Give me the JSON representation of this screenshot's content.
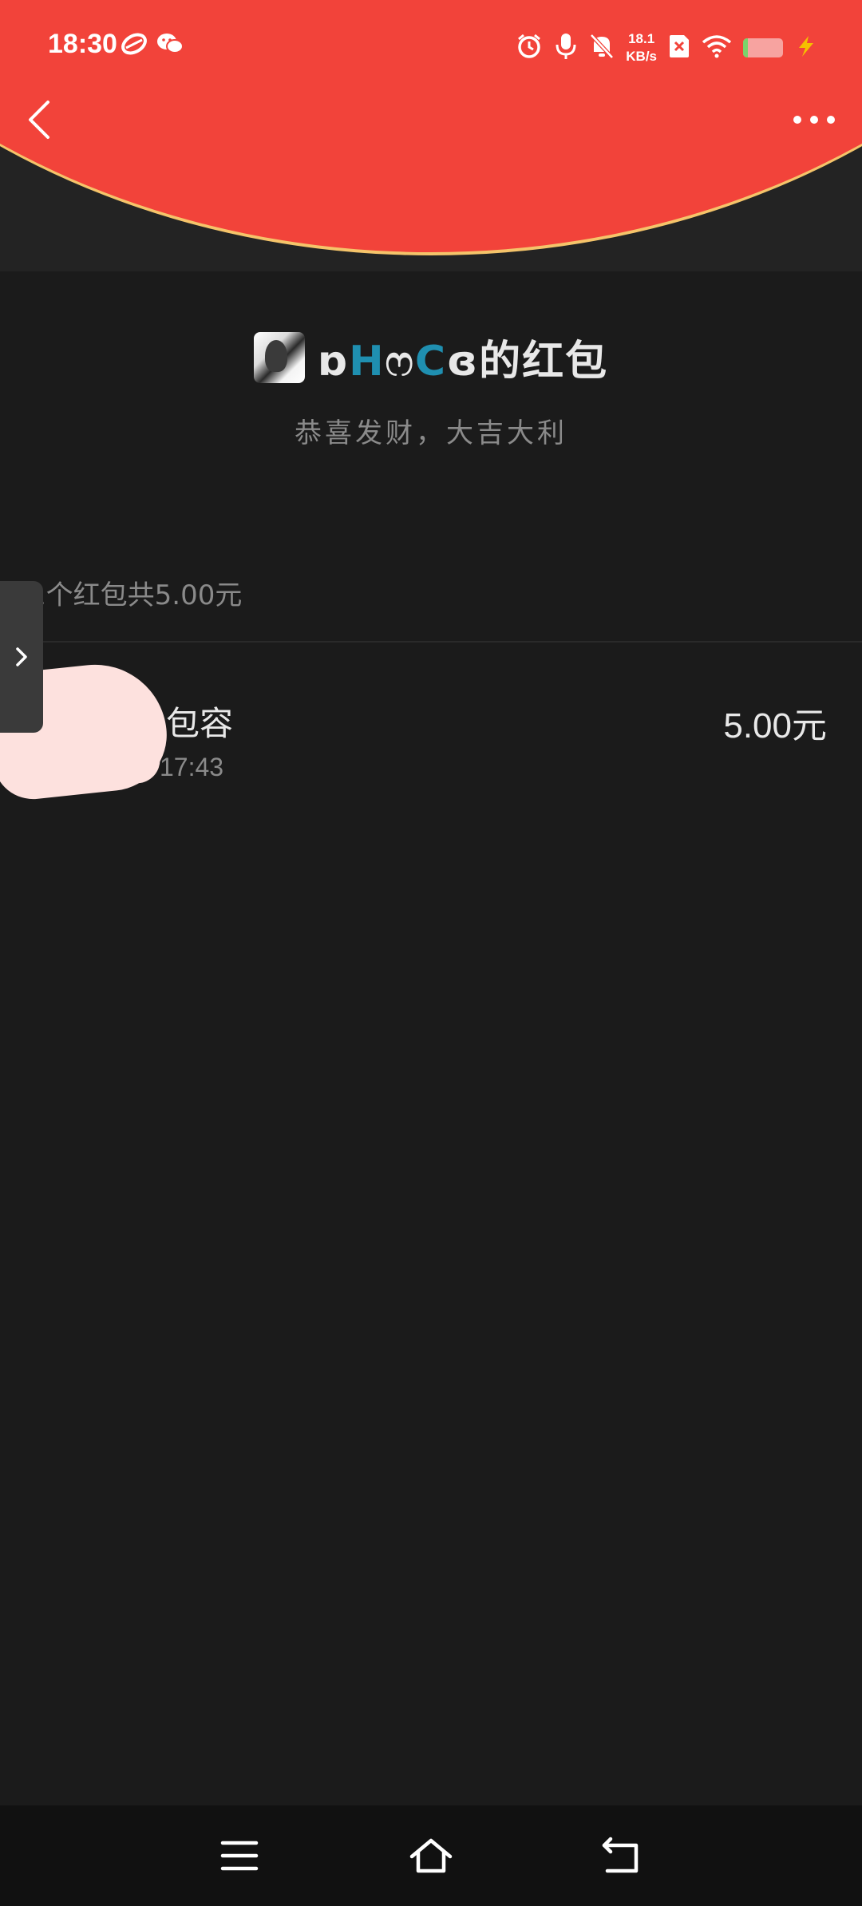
{
  "status_bar": {
    "time": "18:30",
    "net_speed_value": "18.1",
    "net_speed_unit": "KB/s",
    "icons": [
      "game-icon",
      "wechat-icon",
      "alarm-icon",
      "mic-icon",
      "mute-icon",
      "sim-x-icon",
      "wifi-icon",
      "battery-icon",
      "charging-icon"
    ]
  },
  "nav": {
    "back_icon": "chevron-left-icon",
    "more_icon": "more-icon"
  },
  "header": {
    "sender_prefix": "ɒ",
    "sender_h": "H",
    "sender_mid": "ෆ",
    "sender_c": "C",
    "sender_suffix": "ɞ的红包",
    "wish": "恭喜发财，大吉大利"
  },
  "summary": {
    "text": "1个红包共5.00元"
  },
  "records": [
    {
      "name": "包容",
      "time": "17:43",
      "amount": "5.00元"
    }
  ],
  "bottom_nav": {
    "icons": [
      "menu-icon",
      "home-icon",
      "back-icon"
    ]
  },
  "colors": {
    "red": "#f2433a",
    "gold": "#f5c46a",
    "background": "#1b1b1b",
    "accent_blue": "#1f8fb0"
  }
}
